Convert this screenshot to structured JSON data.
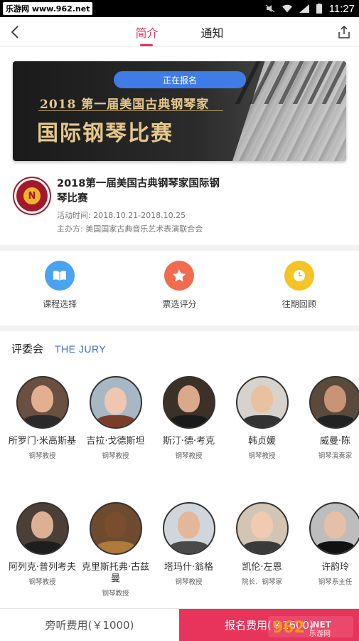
{
  "status": {
    "site": "乐游网 www.962.net",
    "time": "11:27"
  },
  "nav": {
    "tabs": [
      {
        "label": "简介",
        "active": true
      },
      {
        "label": "通知",
        "active": false
      }
    ]
  },
  "banner": {
    "badge": "正在报名",
    "line1": "2018 第一届美国古典钢琴家",
    "line2": "国际钢琴比赛"
  },
  "event": {
    "title": "2018第一届美国古典钢琴家国际钢琴比赛",
    "time": "活动时间: 2018.10.21-2018.10.25",
    "organizer": "主办方: 美国国家古典音乐艺术表演联合会"
  },
  "actions": [
    {
      "label": "课程选择",
      "icon": "book-icon",
      "color": "#4aa3f0"
    },
    {
      "label": "票选评分",
      "icon": "star-icon",
      "color": "#f36b4f"
    },
    {
      "label": "往期回顾",
      "icon": "clock-icon",
      "color": "#f6c324"
    }
  ],
  "jury": {
    "title_cn": "评委会",
    "title_en": "THE JURY",
    "row1": [
      {
        "name": "所罗门·米高斯基",
        "role": "钢琴教授"
      },
      {
        "name": "吉拉·戈德斯坦",
        "role": "钢琴教授"
      },
      {
        "name": "斯汀·德·考克",
        "role": "钢琴教授"
      },
      {
        "name": "韩贞媛",
        "role": "钢琴教授"
      },
      {
        "name": "威曼·陈",
        "role": "钢琴演奏家"
      }
    ],
    "row2": [
      {
        "name": "阿列克·普列考夫",
        "role": "钢琴教授"
      },
      {
        "name": "克里斯托弗·古兹曼",
        "role": "钢琴教授"
      },
      {
        "name": "塔玛什·翁格",
        "role": "钢琴教授"
      },
      {
        "name": "凯伦·左恩",
        "role": "院长、钢琴家"
      },
      {
        "name": "许韵玲",
        "role": "钢琴系主任"
      }
    ]
  },
  "bottom": {
    "audit": "旁听费用(￥1000)",
    "register": "报名费用(￥1600)"
  },
  "colors": {
    "accent": "#e8335a",
    "link": "#3f6ec6"
  }
}
